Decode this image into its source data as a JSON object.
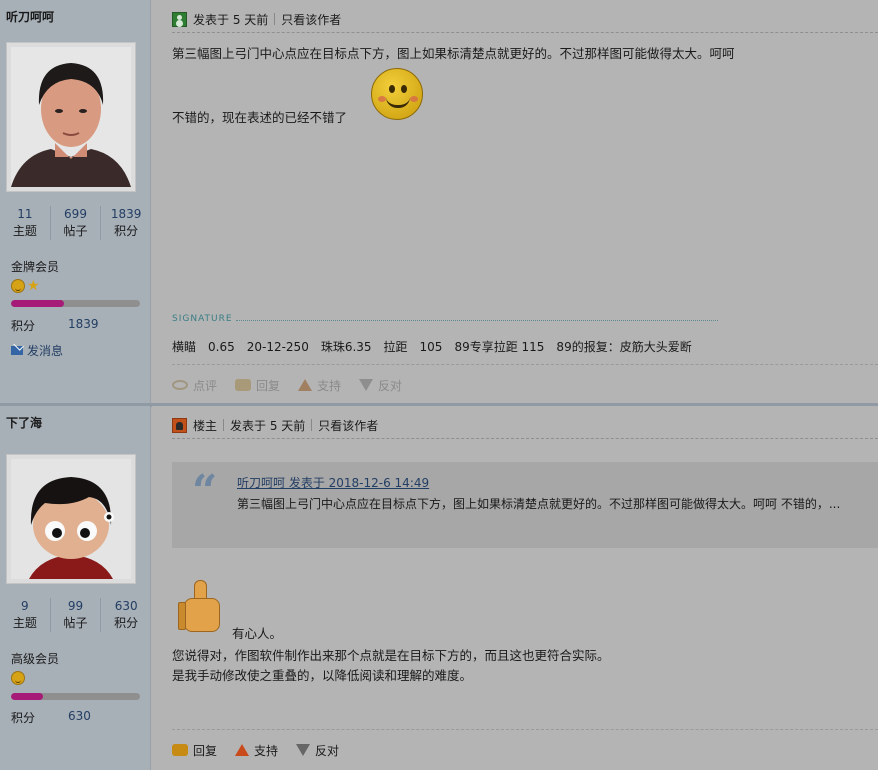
{
  "posts": [
    {
      "author": "听刀呵呵",
      "stats": [
        {
          "value": "11",
          "label": "主题"
        },
        {
          "value": "699",
          "label": "帖子"
        },
        {
          "value": "1839",
          "label": "积分"
        }
      ],
      "rank": "金牌会员",
      "rank_progress": 0.41,
      "score_label": "积分",
      "score_value": "1839",
      "send_message": "发消息",
      "header": {
        "posted": "发表于 5 天前",
        "only_author": "只看该作者"
      },
      "content": {
        "line1": "第三幅图上弓门中心点应在目标点下方，图上如果标清楚点就更好的。不过那样图可能做得太大。呵呵",
        "line2": "不错的，现在表述的已经不错了"
      },
      "signature": {
        "title": "SIGNATURE",
        "text": "横瞄　0.65　20-12-250　珠珠6.35　拉距　105　89专享拉距 115　89的报复：皮筋大头爱断"
      },
      "actions": {
        "comment": "点评",
        "reply": "回复",
        "support": "支持",
        "oppose": "反对"
      }
    },
    {
      "author": "下了海",
      "stats": [
        {
          "value": "9",
          "label": "主题"
        },
        {
          "value": "99",
          "label": "帖子"
        },
        {
          "value": "630",
          "label": "积分"
        }
      ],
      "rank": "高级会员",
      "rank_progress": 0.25,
      "score_label": "积分",
      "score_value": "630",
      "header": {
        "floor": "楼主",
        "posted": "发表于 5 天前",
        "only_author": "只看该作者"
      },
      "quote": {
        "meta": "听刀呵呵 发表于 2018-12-6 14:49",
        "text": "第三幅图上弓门中心点应在目标点下方，图上如果标清楚点就更好的。不过那样图可能做得太大。呵呵 不错的，..."
      },
      "content": {
        "line1": "有心人。",
        "line2": "您说得对，作图软件制作出来那个点就是在目标下方的，而且这也更符合实际。",
        "line3": "是我手动修改使之重叠的，以降低阅读和理解的难度。"
      },
      "actions": {
        "reply": "回复",
        "support": "支持",
        "oppose": "反对"
      }
    }
  ]
}
